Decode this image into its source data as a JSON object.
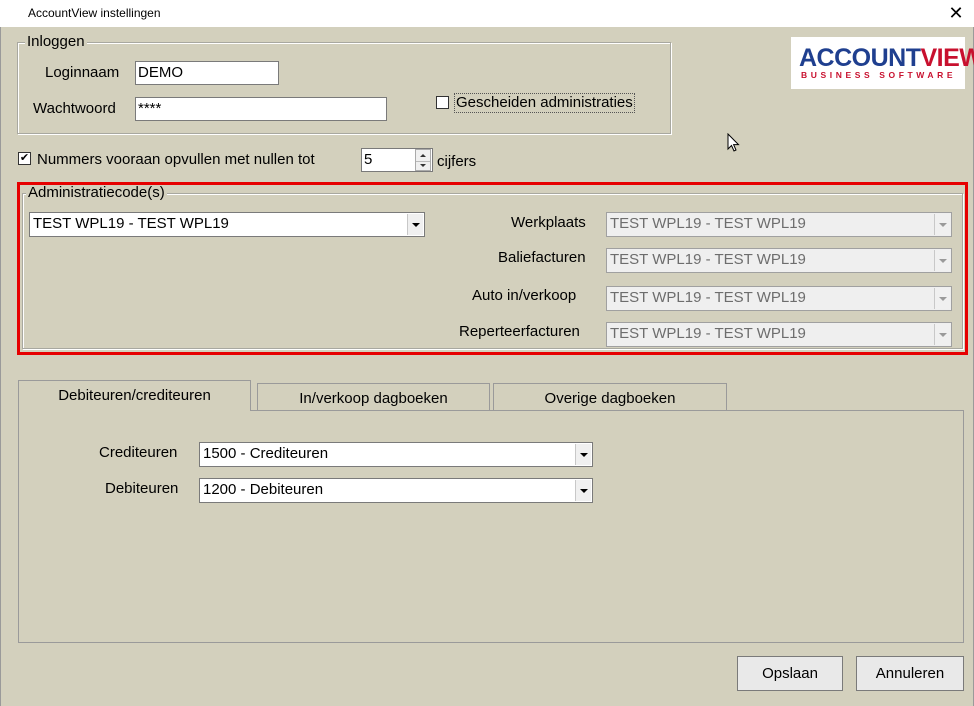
{
  "window": {
    "title": "AccountView instellingen",
    "close_glyph": "✕"
  },
  "logo": {
    "part1": "ACCOUNT",
    "part2": "VIEW",
    "tagline": "BUSINESS SOFTWARE"
  },
  "login": {
    "legend": "Inloggen",
    "username_label": "Loginnaam",
    "username_value": "DEMO",
    "password_label": "Wachtwoord",
    "password_value": "****",
    "separate_admin_label": "Gescheiden administraties",
    "separate_admin_checked": false
  },
  "padding": {
    "checked": true,
    "check_glyph": "✔",
    "label": "Nummers vooraan opvullen met nullen tot",
    "value": "5",
    "suffix": "cijfers"
  },
  "admin_codes": {
    "legend": "Administratiecode(s)",
    "main_value": "TEST WPL19 - TEST WPL19",
    "rows": [
      {
        "label": "Werkplaats",
        "value": "TEST WPL19 - TEST WPL19"
      },
      {
        "label": "Baliefacturen",
        "value": "TEST WPL19 - TEST WPL19"
      },
      {
        "label": "Auto in/verkoop",
        "value": "TEST WPL19 - TEST WPL19"
      },
      {
        "label": "Reperteerfacturen",
        "value": "TEST WPL19 - TEST WPL19"
      }
    ]
  },
  "tabs": [
    {
      "label": "Debiteuren/crediteuren",
      "active": true
    },
    {
      "label": "In/verkoop dagboeken",
      "active": false
    },
    {
      "label": "Overige dagboeken",
      "active": false
    }
  ],
  "accounts": {
    "creditors_label": "Crediteuren",
    "creditors_value": "1500 - Crediteuren",
    "debtors_label": "Debiteuren",
    "debtors_value": "1200 - Debiteuren"
  },
  "buttons": {
    "save": "Opslaan",
    "cancel": "Annuleren"
  }
}
